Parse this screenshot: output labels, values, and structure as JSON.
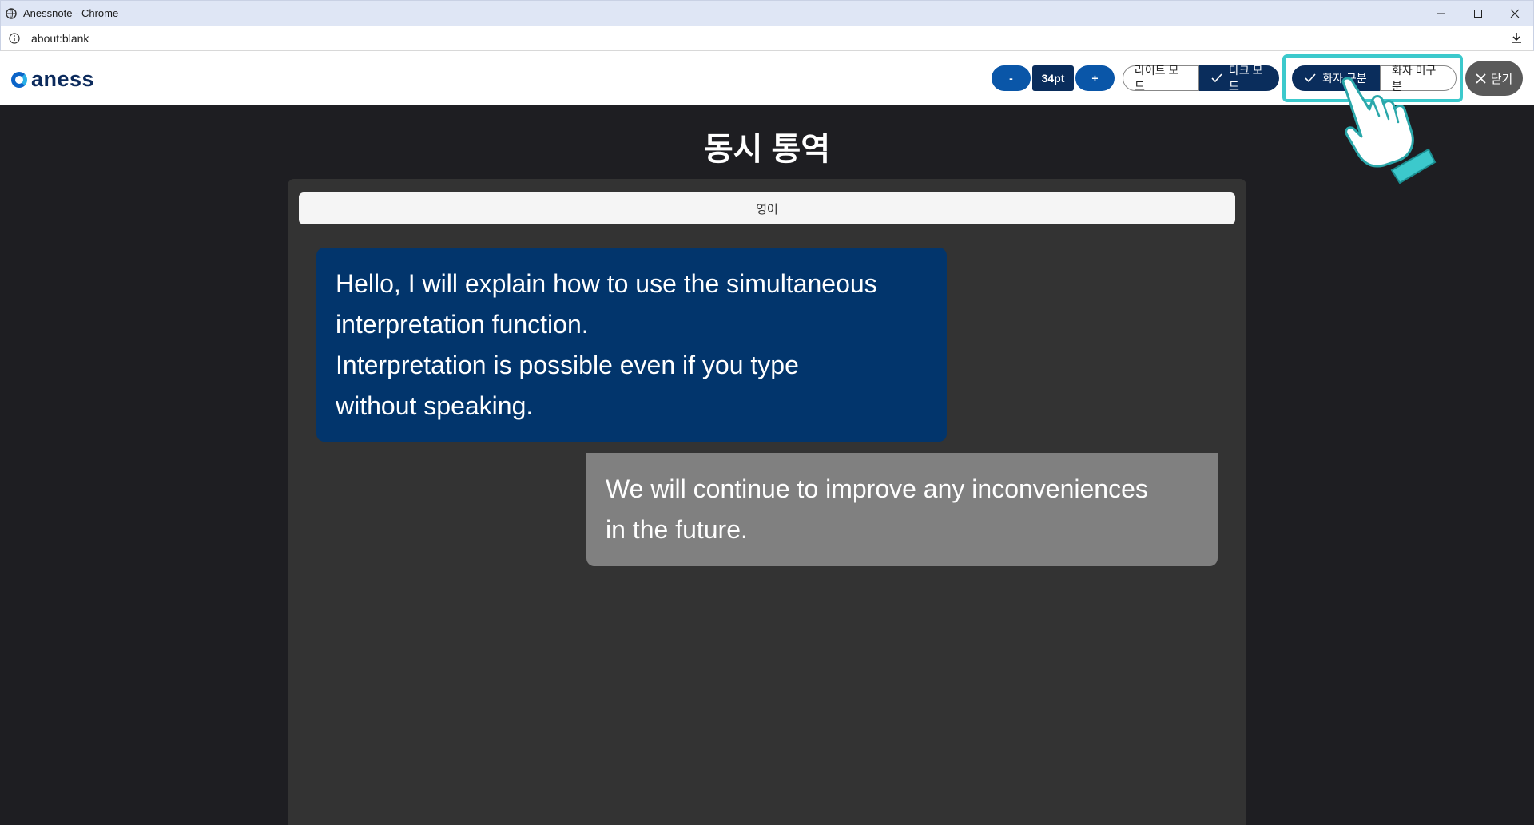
{
  "window": {
    "title": "Anessnote - Chrome",
    "url": "about:blank"
  },
  "header": {
    "logo_text": "aness",
    "font": {
      "decrease_label": "-",
      "size_label": "34pt",
      "increase_label": "+"
    },
    "mode": {
      "light_label": "라이트 모드",
      "dark_label": "다크 모드",
      "selected": "dark"
    },
    "speaker": {
      "distinguish_label": "화자 구분",
      "not_distinguish_label": "화자 미구분",
      "selected": "distinguish"
    },
    "close_label": "닫기"
  },
  "main": {
    "title": "동시 통역",
    "language": "영어",
    "messages": [
      {
        "lines": [
          "Hello, I will explain how to use the simultaneous",
          "interpretation function.",
          "Interpretation is possible even if you type",
          "without speaking."
        ],
        "color": "#02356c"
      },
      {
        "lines": [
          "We will continue to improve any inconveniences",
          "in the future."
        ],
        "color": "#808080"
      }
    ]
  },
  "colors": {
    "accent_dark": "#0a2d5c",
    "accent_blue": "#0a56a8",
    "highlight": "#3cc9cc",
    "background": "#1e1e22",
    "panel": "#333333"
  }
}
